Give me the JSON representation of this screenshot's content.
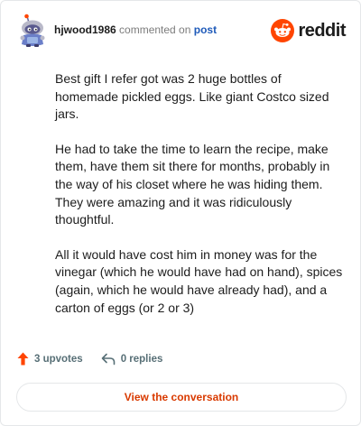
{
  "comment": {
    "username": "hjwood1986",
    "action_text": "commented on",
    "post_link": "post",
    "paragraphs": [
      "Best gift I refer got was 2 huge bottles of homemade pickled eggs. Like giant Costco sized jars.",
      "He had to take the time to learn the recipe, make them, have them sit there for months, probably in the way of his closet where he was hiding them. They were amazing and it was ridiculously thoughtful.",
      "All it would have cost him in money was for the vinegar (which he would have had on hand), spices (again, which he would have already had), and a carton of eggs (or 2 or 3)"
    ]
  },
  "brand": {
    "name": "reddit",
    "color": "#ff4500"
  },
  "stats": {
    "upvotes": "3 upvotes",
    "replies": "0 replies"
  },
  "cta": {
    "label": "View the conversation"
  },
  "colors": {
    "accent": "#d93a00",
    "link": "#1e5ab9",
    "upvote": "#ff4500",
    "muted": "#576f76"
  },
  "icons": {
    "avatar": "snoo-avatar",
    "logo": "reddit-logo-icon",
    "upvote": "upvote-arrow-icon",
    "reply": "reply-arrow-icon"
  }
}
